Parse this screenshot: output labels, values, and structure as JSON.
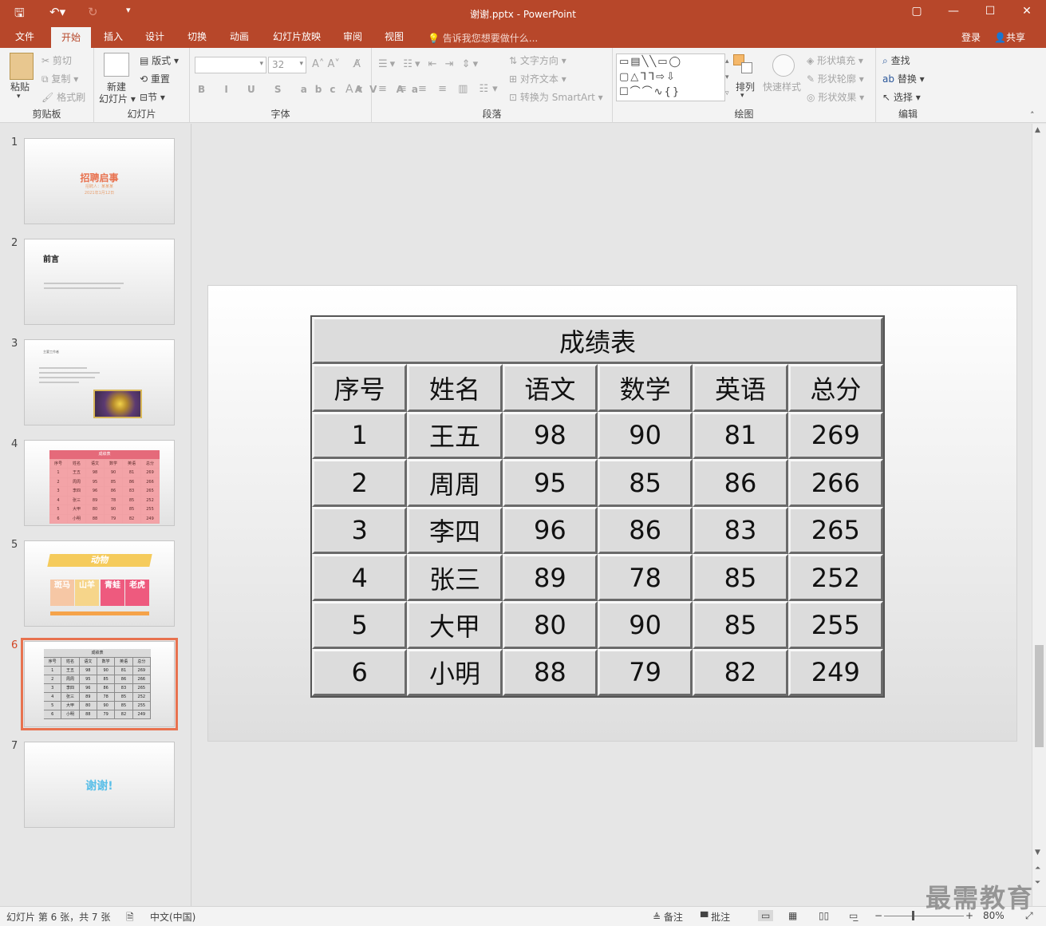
{
  "window": {
    "title": "谢谢.pptx - PowerPoint",
    "controls": [
      "▢",
      "—",
      "☐",
      "✕"
    ]
  },
  "quick_access": {
    "save_icon": "save-icon",
    "undo_icon": "undo-icon",
    "redo_icon": "redo-icon",
    "customize_icon": "customize-icon"
  },
  "tabs": [
    "文件",
    "开始",
    "插入",
    "设计",
    "切换",
    "动画",
    "幻灯片放映",
    "审阅",
    "视图"
  ],
  "active_tab": "开始",
  "tell_me": "告诉我您想要做什么...",
  "account": {
    "login": "登录",
    "share": "共享"
  },
  "ribbon": {
    "clipboard": {
      "label": "剪贴板",
      "paste": "粘贴",
      "cut": "剪切",
      "copy": "复制",
      "format_painter": "格式刷"
    },
    "slides": {
      "label": "幻灯片",
      "new_slide_line1": "新建",
      "new_slide_line2": "幻灯片",
      "layout": "版式",
      "reset": "重置",
      "section": "节"
    },
    "font": {
      "label": "字体",
      "font_name": "",
      "font_size": "32"
    },
    "paragraph": {
      "label": "段落",
      "text_direction": "文字方向",
      "align_text": "对齐文本",
      "convert_smartart": "转换为 SmartArt"
    },
    "drawing": {
      "label": "绘图",
      "arrange": "排列",
      "quick_styles": "快速样式",
      "shape_fill": "形状填充",
      "shape_outline": "形状轮廓",
      "shape_effects": "形状效果"
    },
    "editing": {
      "label": "编辑",
      "find": "查找",
      "replace": "替换",
      "select": "选择"
    }
  },
  "thumbnails": [
    {
      "num": "1",
      "title": "招聘启事",
      "subtitle": "招聘人：某某某",
      "date": "2021年1月12日"
    },
    {
      "num": "2",
      "title": "前言"
    },
    {
      "num": "3",
      "title": "主要工作者"
    },
    {
      "num": "4",
      "title": "成绩表"
    },
    {
      "num": "5",
      "title": "动物",
      "items": [
        "斑马",
        "山羊",
        "青蛙",
        "老虎"
      ]
    },
    {
      "num": "6",
      "title": "成绩表"
    },
    {
      "num": "7",
      "title": "谢谢!"
    }
  ],
  "current_slide_index": 6,
  "table": {
    "title": "成绩表",
    "headers": [
      "序号",
      "姓名",
      "语文",
      "数学",
      "英语",
      "总分"
    ],
    "rows": [
      [
        "1",
        "王五",
        "98",
        "90",
        "81",
        "269"
      ],
      [
        "2",
        "周周",
        "95",
        "85",
        "86",
        "266"
      ],
      [
        "3",
        "李四",
        "96",
        "86",
        "83",
        "265"
      ],
      [
        "4",
        "张三",
        "89",
        "78",
        "85",
        "252"
      ],
      [
        "5",
        "大甲",
        "80",
        "90",
        "85",
        "255"
      ],
      [
        "6",
        "小明",
        "88",
        "79",
        "82",
        "249"
      ]
    ]
  },
  "status": {
    "slide_info": "幻灯片 第 6 张，共 7 张",
    "language": "中文(中国)",
    "notes": "备注",
    "comments": "批注",
    "zoom": "80%"
  },
  "watermark": "最需教育",
  "colors": {
    "accent": "#b7472a",
    "selection": "#e8724f"
  }
}
